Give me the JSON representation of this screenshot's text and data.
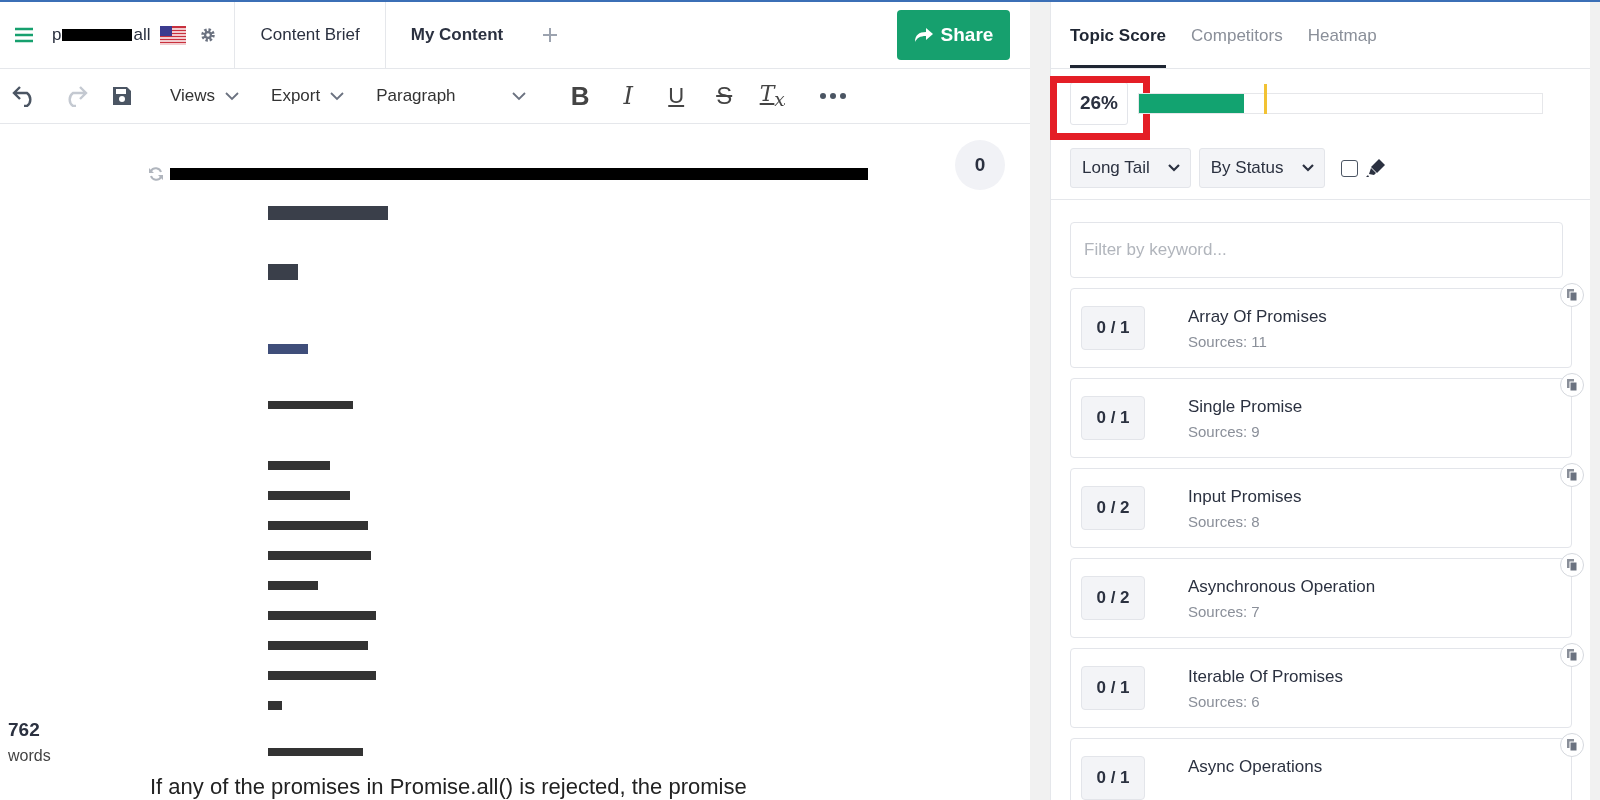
{
  "header": {
    "doc_name_start": "p",
    "doc_name_end": "all",
    "tabs": [
      {
        "label": "Content Brief",
        "selected": false
      },
      {
        "label": "My Content",
        "selected": true
      }
    ],
    "share": "Share"
  },
  "toolbar": {
    "menus": [
      "Views",
      "Export"
    ],
    "block_format": "Paragraph",
    "format_buttons": [
      {
        "kind": "bold",
        "label": "B"
      },
      {
        "kind": "italic",
        "label": "I"
      },
      {
        "kind": "underline",
        "label": "U"
      },
      {
        "kind": "strike",
        "label": "S"
      },
      {
        "kind": "clear",
        "label": "T$_{x}$"
      }
    ]
  },
  "editor": {
    "comment_count": "0",
    "paragraph": "If any of the promises in Promise.all() is rejected, the promise",
    "word_count": "762",
    "word_label": "words"
  },
  "panel": {
    "tabs": [
      {
        "label": "Topic Score",
        "selected": true
      },
      {
        "label": "Competitors",
        "selected": false
      },
      {
        "label": "Heatmap",
        "selected": false
      }
    ],
    "score": "26%",
    "score_highlighted": true,
    "score_bar": {
      "level": 0.26
    },
    "target_marker": {
      "level": 0.31
    },
    "filters": [
      "Long Tail",
      "By Status"
    ],
    "highlight_checked": false,
    "filter_placeholder": "Filter by keyword...",
    "keywords": [
      {
        "count": "0 / 1",
        "name": "Array Of Promises",
        "sources": "Sources: 11"
      },
      {
        "count": "0 / 1",
        "name": "Single Promise",
        "sources": "Sources: 9"
      },
      {
        "count": "0 / 2",
        "name": "Input Promises",
        "sources": "Sources: 8"
      },
      {
        "count": "0 / 2",
        "name": "Asynchronous Operation",
        "sources": "Sources: 7"
      },
      {
        "count": "0 / 1",
        "name": "Iterable Of Promises",
        "sources": "Sources: 6"
      },
      {
        "count": "0 / 1",
        "name": "Async Operations"
      }
    ]
  }
}
